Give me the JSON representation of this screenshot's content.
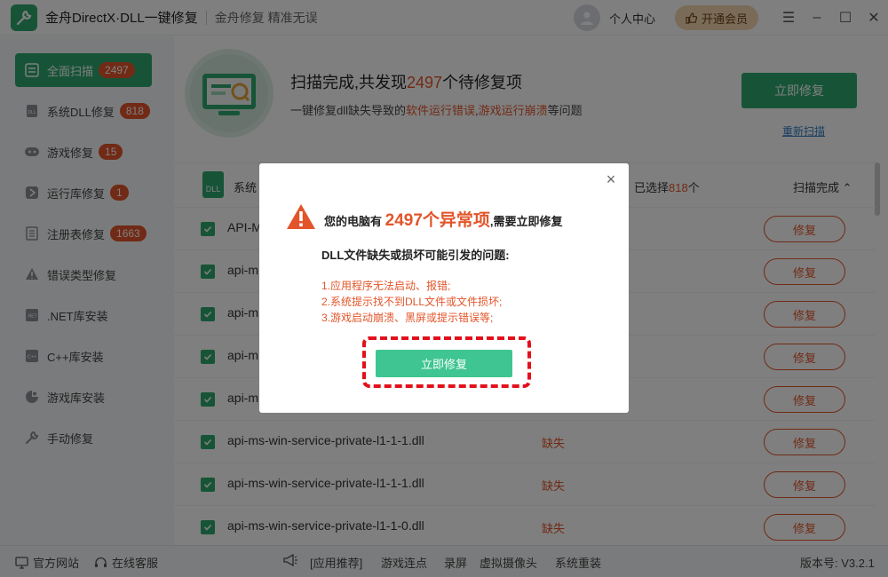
{
  "app": {
    "title": "金舟DirectX·DLL一键修复",
    "slogan": "金舟修复 精准无误",
    "user_center": "个人中心",
    "vip_label": "开通会员"
  },
  "sidebar": {
    "items": [
      {
        "label": "全面扫描",
        "badge": "2497",
        "icon": "scan-icon"
      },
      {
        "label": "系统DLL修复",
        "badge": "818",
        "icon": "dll-icon"
      },
      {
        "label": "游戏修复",
        "badge": "15",
        "icon": "gamepad-icon"
      },
      {
        "label": "运行库修复",
        "badge": "1",
        "icon": "runtime-icon"
      },
      {
        "label": "注册表修复",
        "badge": "1663",
        "icon": "registry-icon"
      },
      {
        "label": "错误类型修复",
        "badge": "",
        "icon": "warning-icon"
      },
      {
        "label": ".NET库安装",
        "badge": "",
        "icon": "dotnet-icon"
      },
      {
        "label": "C++库安装",
        "badge": "",
        "icon": "cpp-icon"
      },
      {
        "label": "游戏库安装",
        "badge": "",
        "icon": "game-library-icon"
      },
      {
        "label": "手动修复",
        "badge": "",
        "icon": "tools-icon"
      }
    ]
  },
  "hero": {
    "title_prefix": "扫描完成,共发现",
    "count": "2497",
    "title_suffix": "个待修复项",
    "sub_prefix": "一键修复dll缺失导致的",
    "sub_hl1": "软件运行错误",
    "sub_sep": ",",
    "sub_hl2": "游戏运行崩溃",
    "sub_suffix": "等问题",
    "fix_button": "立即修复",
    "rescan": "重新扫描"
  },
  "list": {
    "header_label": "系统",
    "selected_prefix": "已选择",
    "selected_count": "818",
    "selected_suffix": "个",
    "status_label": "扫描完成",
    "dll_icon_text": "DLL",
    "rows": [
      {
        "name": "API-M",
        "status": "",
        "action": "修复"
      },
      {
        "name": "api-m",
        "status": "",
        "action": "修复"
      },
      {
        "name": "api-m",
        "status": "",
        "action": "修复"
      },
      {
        "name": "api-m",
        "status": "",
        "action": "修复"
      },
      {
        "name": "api-m",
        "status": "",
        "action": "修复"
      },
      {
        "name": "api-ms-win-service-private-l1-1-1.dll",
        "status": "缺失",
        "action": "修复"
      },
      {
        "name": "api-ms-win-service-private-l1-1-1.dll",
        "status": "缺失",
        "action": "修复"
      },
      {
        "name": "api-ms-win-service-private-l1-1-0.dll",
        "status": "缺失",
        "action": "修复"
      }
    ]
  },
  "footer": {
    "website": "官方网站",
    "service": "在线客服",
    "recommend": "[应用推荐]",
    "link1": "游戏连点",
    "link2": "录屏",
    "link3": "虚拟摄像头",
    "link4": "系统重装",
    "version": "版本号: V3.2.1"
  },
  "dialog": {
    "title_prefix": "您的电脑有",
    "title_count": "2497个异常项",
    "title_suffix": ",需要立即修复",
    "subtitle": "DLL文件缺失或损坏可能引发的问题:",
    "issues": [
      "1.应用程序无法启动、报错;",
      "2.系统提示找不到DLL文件或文件损坏;",
      "3.游戏启动崩溃、黑屏或提示错误等;"
    ],
    "fix_button": "立即修复",
    "close_symbol": "×"
  },
  "colors": {
    "brand_green": "#2fa86f",
    "accent_red": "#e2552a",
    "dialog_button": "#3ec591",
    "highlight_dash": "#e3101b"
  }
}
